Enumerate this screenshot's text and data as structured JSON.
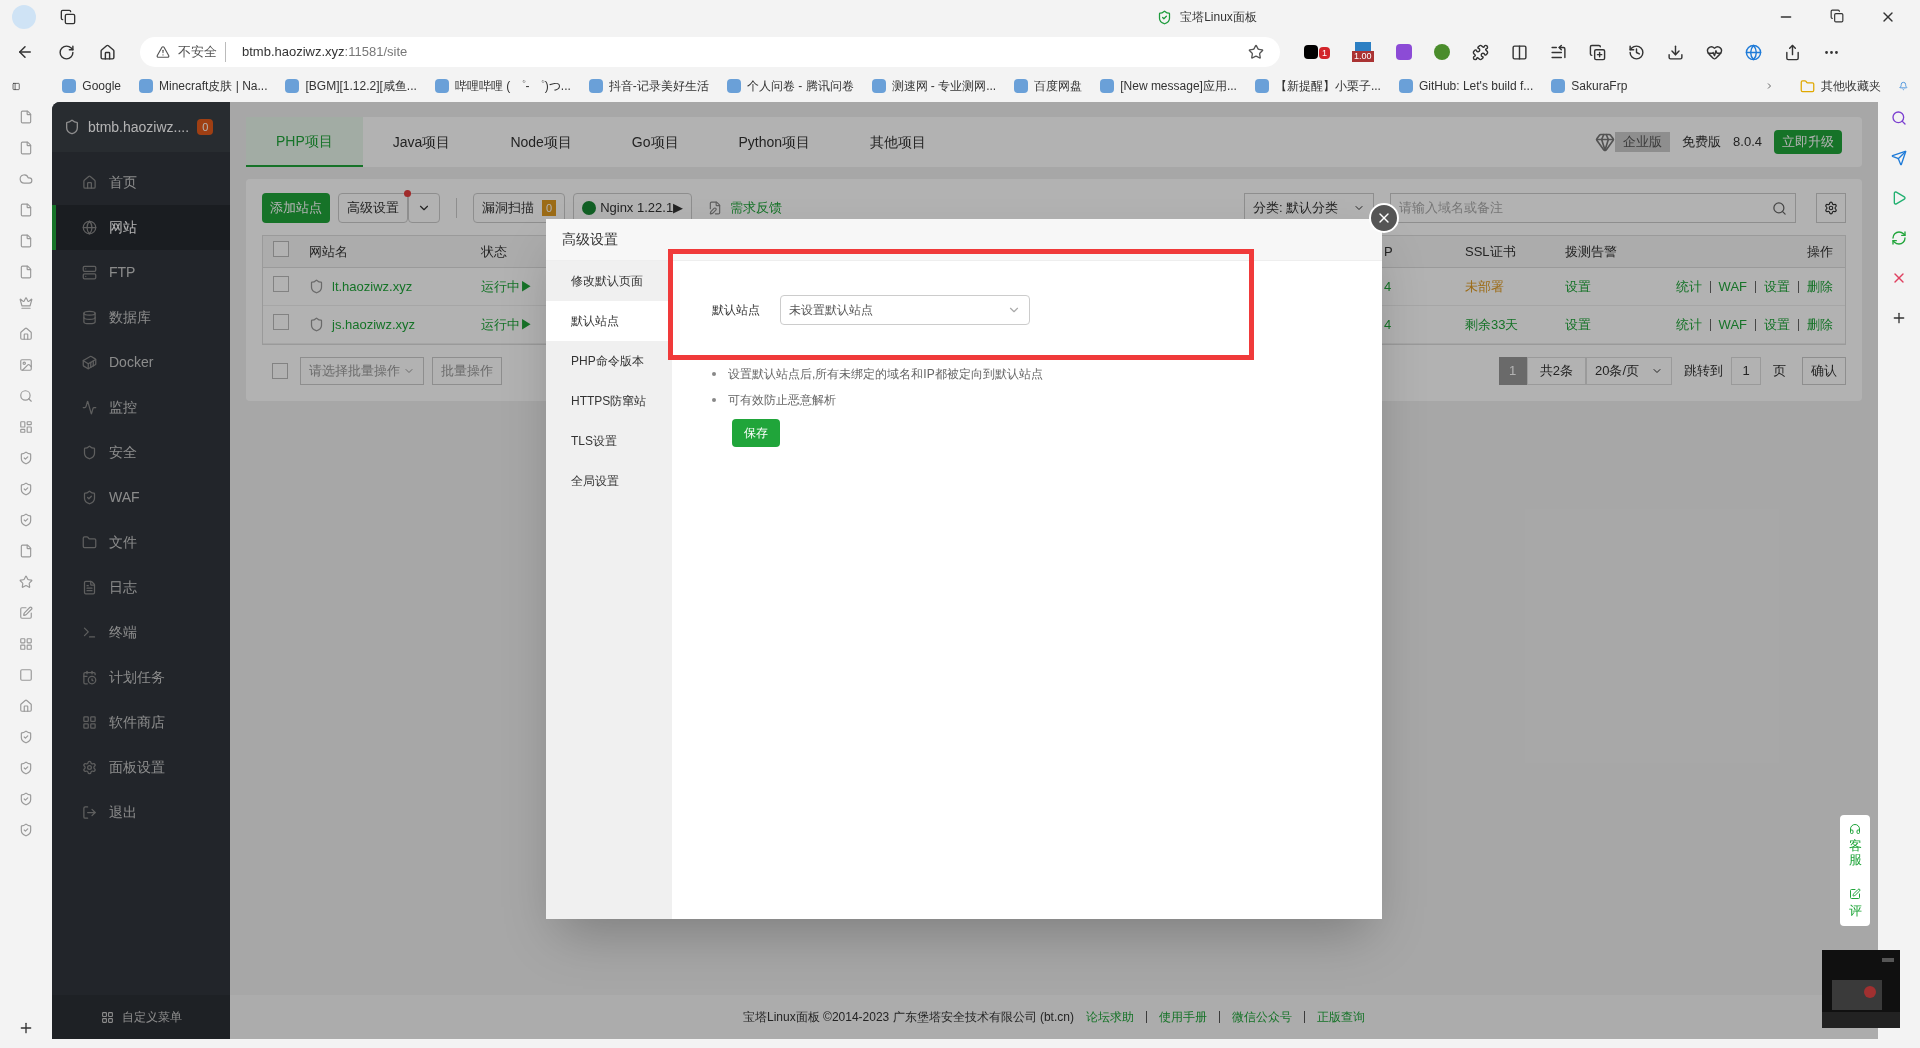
{
  "browser": {
    "title": "宝塔Linux面板",
    "security": "不安全",
    "url_host": "btmb.haoziwz.xyz",
    "url_rest": ":11581/site",
    "extension_badges": [
      "1",
      "1.00"
    ],
    "bookmarks": [
      "Google",
      "Minecraft皮肤 | Na...",
      "[BGM][1.12.2][咸鱼...",
      "哔哩哔哩 ( ゜- ゜)つ...",
      "抖音-记录美好生活",
      "个人问卷 - 腾讯问卷",
      "测速网 - 专业测网...",
      "百度网盘",
      "[New message]应用...",
      "【新提醒】小栗子...",
      "GitHub: Let's build f...",
      "SakuraFrp"
    ],
    "other_bookmarks": "其他收藏夹"
  },
  "sidebar": {
    "host": "btmb.haoziwz....",
    "badge": "0",
    "items": [
      {
        "label": "首页",
        "selected": false
      },
      {
        "label": "网站",
        "selected": true
      },
      {
        "label": "FTP",
        "selected": false
      },
      {
        "label": "数据库",
        "selected": false
      },
      {
        "label": "Docker",
        "selected": false
      },
      {
        "label": "监控",
        "selected": false
      },
      {
        "label": "安全",
        "selected": false
      },
      {
        "label": "WAF",
        "selected": false
      },
      {
        "label": "文件",
        "selected": false
      },
      {
        "label": "日志",
        "selected": false
      },
      {
        "label": "终端",
        "selected": false
      },
      {
        "label": "计划任务",
        "selected": false
      },
      {
        "label": "软件商店",
        "selected": false
      },
      {
        "label": "面板设置",
        "selected": false
      },
      {
        "label": "退出",
        "selected": false
      }
    ],
    "footer": "自定义菜单"
  },
  "project_tabs": [
    {
      "label": "PHP项目",
      "selected": true
    },
    {
      "label": "Java项目",
      "selected": false
    },
    {
      "label": "Node项目",
      "selected": false
    },
    {
      "label": "Go项目",
      "selected": false
    },
    {
      "label": "Python项目",
      "selected": false
    },
    {
      "label": "其他项目",
      "selected": false
    }
  ],
  "edition": {
    "enterprise": "企业版",
    "free": "免费版",
    "version": "8.0.4",
    "upgrade": "立即升级"
  },
  "toolbar": {
    "add_site": "添加站点",
    "advanced": "高级设置",
    "advanced_dot": true,
    "scan": "漏洞扫描",
    "scan_count": "0",
    "nginx": "Nginx 1.22.1▶",
    "feedback": "需求反馈",
    "category": "分类: 默认分类",
    "search_placeholder": "请输入域名或备注"
  },
  "table": {
    "all_checked": false,
    "columns": [
      "网站名",
      "状态",
      "P",
      "SSL证书",
      "拨测告警",
      "操作"
    ],
    "rows": [
      {
        "checked": false,
        "name": "lt.haoziwz.xyz",
        "status": "运行中▶",
        "column_3": "4",
        "ssl": "未部署",
        "ssl_ok": false,
        "alert": "设置",
        "actions": [
          "统计",
          "WAF",
          "设置",
          "删除"
        ]
      },
      {
        "checked": false,
        "name": "js.haoziwz.xyz",
        "status": "运行中▶",
        "column_3": "4",
        "ssl": "剩余33天",
        "ssl_ok": true,
        "alert": "设置",
        "actions": [
          "统计",
          "WAF",
          "设置",
          "删除"
        ]
      }
    ]
  },
  "batch": {
    "checked": false,
    "placeholder": "请选择批量操作",
    "button": "批量操作"
  },
  "pagination": {
    "page": "1",
    "total": "共2条",
    "per_page": "20条/页",
    "jump_label": "跳转到",
    "jump_value": "1",
    "page_unit": "页",
    "confirm": "确认"
  },
  "modal": {
    "title": "高级设置",
    "nav": [
      {
        "label": "修改默认页面",
        "selected": false
      },
      {
        "label": "默认站点",
        "selected": true
      },
      {
        "label": "PHP命令版本",
        "selected": false
      },
      {
        "label": "HTTPS防窜站",
        "selected": false
      },
      {
        "label": "TLS设置",
        "selected": false
      },
      {
        "label": "全局设置",
        "selected": false
      }
    ],
    "field_label": "默认站点",
    "field_value": "未设置默认站点",
    "notes": [
      "设置默认站点后,所有未绑定的域名和IP都被定向到默认站点",
      "可有效防止恶意解析"
    ],
    "save": "保存",
    "highlighted": true
  },
  "footer": {
    "copyright": "宝塔Linux面板 ©2014-2023 广东堡塔安全技术有限公司 (bt.cn)",
    "links": [
      "论坛求助",
      "使用手册",
      "微信公众号",
      "正版查询"
    ]
  },
  "float_tabs": [
    "客服",
    "评"
  ]
}
